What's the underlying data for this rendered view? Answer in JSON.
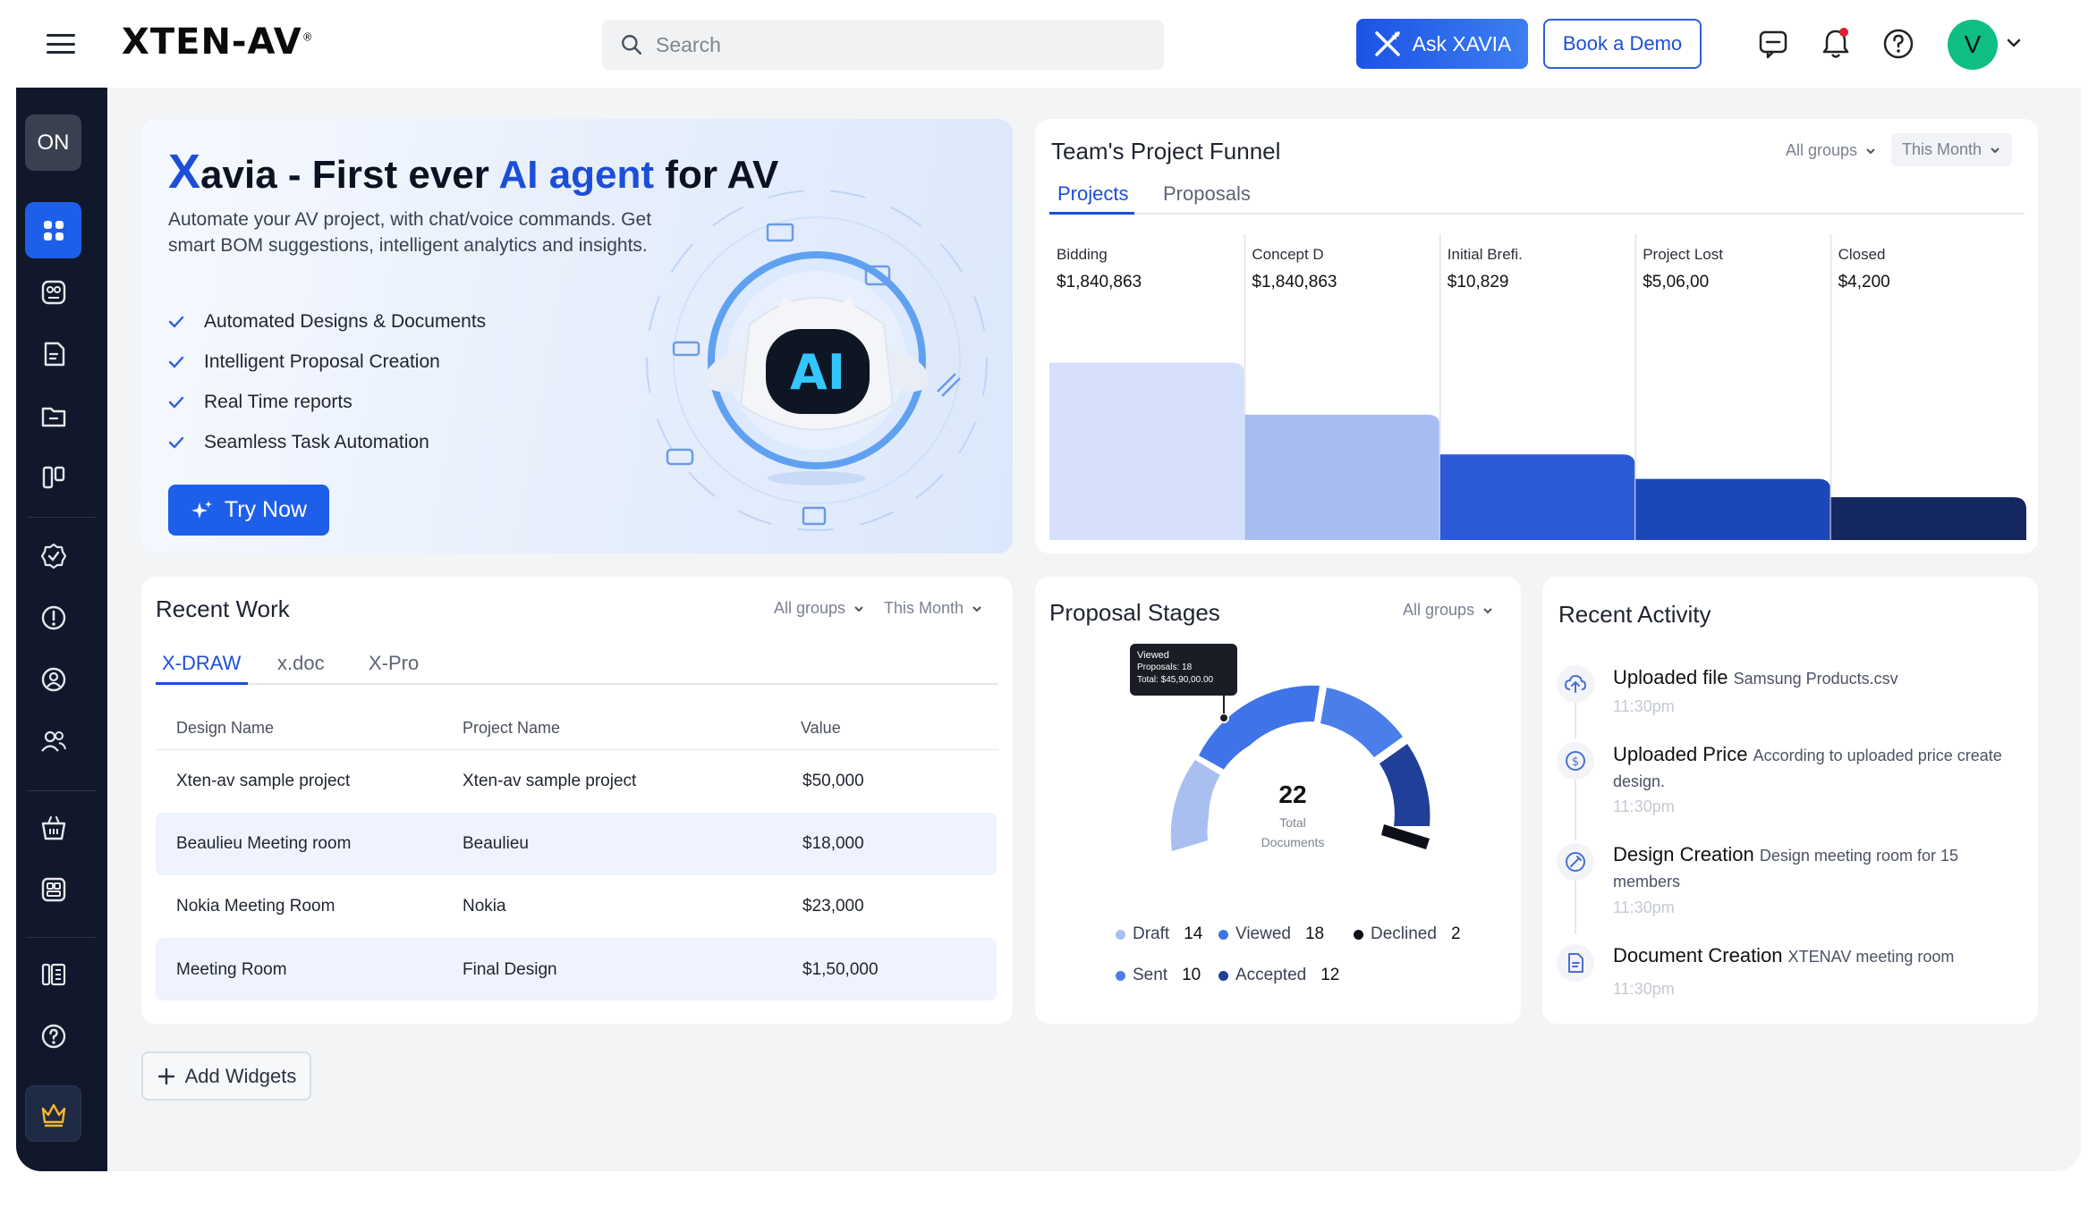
{
  "header": {
    "logo": "XTEN-AV",
    "logo_mark": "®",
    "search_placeholder": "Search",
    "ask_label": "Ask XAVIA",
    "demo_label": "Book a Demo",
    "avatar_initial": "V",
    "notification_color": "#e11d2e"
  },
  "sidebar": {
    "toggle_label": "ON",
    "items": [
      "dashboard",
      "projects",
      "documents",
      "folder",
      "boards",
      "tasks",
      "alerts",
      "support",
      "contacts",
      "store",
      "catalog",
      "library",
      "help",
      "premium"
    ]
  },
  "hero": {
    "brand_x": "X",
    "brand_rest": "avia",
    "title_mid": " - First ever ",
    "title_blue": "AI agent",
    "title_end": " for AV",
    "description": "Automate your AV project, with chat/voice commands. Get smart BOM suggestions, intelligent analytics and insights.",
    "features": [
      "Automated Designs & Documents",
      "Intelligent Proposal Creation",
      "Real Time reports",
      "Seamless Task Automation"
    ],
    "button": "Try Now",
    "robot_text": "AI"
  },
  "funnel": {
    "title": "Team's Project Funnel",
    "filter_groups": "All groups",
    "filter_period": "This Month",
    "tabs": [
      "Projects",
      "Proposals"
    ],
    "active_tab": "Projects",
    "stages": [
      {
        "label": "Bidding",
        "value": "$1,840,863",
        "level": 0.58,
        "color": "#d6e0fa"
      },
      {
        "label": "Concept  D",
        "value": "$1,840,863",
        "level": 0.41,
        "color": "#a7bdf2"
      },
      {
        "label": "Initial Brefi.",
        "value": "$10,829",
        "level": 0.28,
        "color": "#2a5ad6"
      },
      {
        "label": "Project Lost",
        "value": "$5,06,00",
        "level": 0.2,
        "color": "#1c47b8"
      },
      {
        "label": "Closed",
        "value": "$4,200",
        "level": 0.14,
        "color": "#14275e"
      }
    ]
  },
  "recent_work": {
    "title": "Recent Work",
    "filter_groups": "All groups",
    "filter_period": "This Month",
    "tabs": [
      "X-DRAW",
      "x.doc",
      "X-Pro"
    ],
    "active_tab": "X-DRAW",
    "columns": [
      "Design Name",
      "Project Name",
      "Value"
    ],
    "rows": [
      [
        "Xten-av sample project",
        "Xten-av sample project",
        "$50,000"
      ],
      [
        "Beaulieu Meeting room",
        "Beaulieu",
        "$18,000"
      ],
      [
        "Nokia Meeting Room",
        "Nokia",
        "$23,000"
      ],
      [
        "Meeting Room",
        "Final Design",
        "$1,50,000"
      ]
    ]
  },
  "proposal_stages": {
    "title": "Proposal Stages",
    "filter_groups": "All groups",
    "total": "22",
    "total_label_1": "Total",
    "total_label_2": "Documents",
    "tooltip": {
      "line1": "Viewed",
      "line2": "Proposals: 18",
      "line3": "Total: $45,90,00.00"
    },
    "legend": [
      {
        "name": "Draft",
        "count": "14",
        "color": "#a9bff0"
      },
      {
        "name": "Viewed",
        "count": "18",
        "color": "#3f73e8"
      },
      {
        "name": "Declined",
        "count": "2",
        "color": "#0c0f17"
      },
      {
        "name": "Sent",
        "count": "10",
        "color": "#4a7fea"
      },
      {
        "name": "Accepted",
        "count": "12",
        "color": "#1f3f98"
      }
    ]
  },
  "recent_activity": {
    "title": "Recent Activity",
    "items": [
      {
        "icon": "upload-icon",
        "title": "Uploaded file",
        "detail": "Samsung Products.csv",
        "time": "11:30pm"
      },
      {
        "icon": "price-icon",
        "title": "Uploaded Price",
        "detail": "According to uploaded price create design.",
        "time": "11:30pm"
      },
      {
        "icon": "design-icon",
        "title": "Design Creation",
        "detail": "Design meeting room for 15 members",
        "time": "11:30pm"
      },
      {
        "icon": "document-icon",
        "title": "Document Creation",
        "detail": "XTENAV meeting room",
        "time": "11:30pm"
      }
    ]
  },
  "add_widgets": "Add Widgets"
}
